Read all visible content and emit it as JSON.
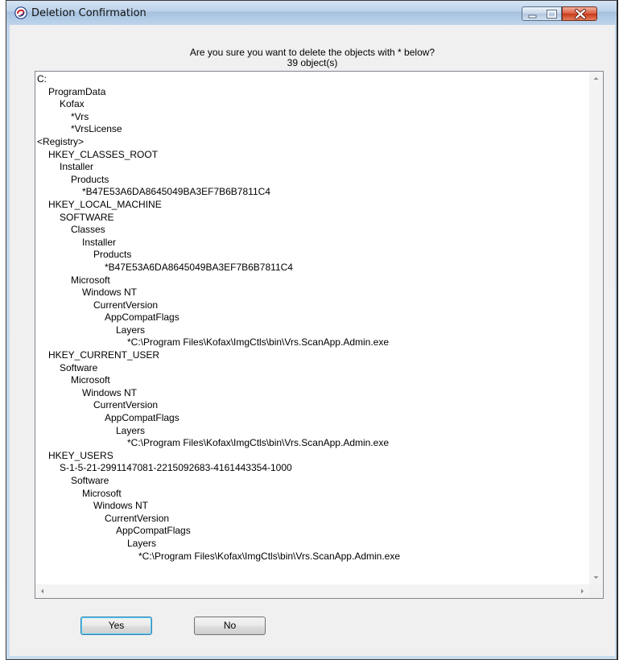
{
  "window": {
    "title": "Deletion Confirmation",
    "icon": "app-swirl-icon"
  },
  "dialog": {
    "question": "Are you sure you want to delete the objects with * below?",
    "count": "39 object(s)"
  },
  "tree": [
    {
      "indent": 0,
      "text": "C:"
    },
    {
      "indent": 1,
      "text": "ProgramData"
    },
    {
      "indent": 2,
      "text": "Kofax"
    },
    {
      "indent": 3,
      "text": "*Vrs"
    },
    {
      "indent": 3,
      "text": "*VrsLicense"
    },
    {
      "indent": 0,
      "text": "<Registry>"
    },
    {
      "indent": 1,
      "text": "HKEY_CLASSES_ROOT"
    },
    {
      "indent": 2,
      "text": "Installer"
    },
    {
      "indent": 3,
      "text": "Products"
    },
    {
      "indent": 4,
      "text": "*B47E53A6DA8645049BA3EF7B6B7811C4"
    },
    {
      "indent": 1,
      "text": "HKEY_LOCAL_MACHINE"
    },
    {
      "indent": 2,
      "text": "SOFTWARE"
    },
    {
      "indent": 3,
      "text": "Classes"
    },
    {
      "indent": 4,
      "text": "Installer"
    },
    {
      "indent": 5,
      "text": "Products"
    },
    {
      "indent": 6,
      "text": "*B47E53A6DA8645049BA3EF7B6B7811C4"
    },
    {
      "indent": 3,
      "text": "Microsoft"
    },
    {
      "indent": 4,
      "text": "Windows NT"
    },
    {
      "indent": 5,
      "text": "CurrentVersion"
    },
    {
      "indent": 6,
      "text": "AppCompatFlags"
    },
    {
      "indent": 7,
      "text": "Layers"
    },
    {
      "indent": 8,
      "text": "*C:\\Program Files\\Kofax\\ImgCtls\\bin\\Vrs.ScanApp.Admin.exe"
    },
    {
      "indent": 1,
      "text": "HKEY_CURRENT_USER"
    },
    {
      "indent": 2,
      "text": "Software"
    },
    {
      "indent": 3,
      "text": "Microsoft"
    },
    {
      "indent": 4,
      "text": "Windows NT"
    },
    {
      "indent": 5,
      "text": "CurrentVersion"
    },
    {
      "indent": 6,
      "text": "AppCompatFlags"
    },
    {
      "indent": 7,
      "text": "Layers"
    },
    {
      "indent": 8,
      "text": "*C:\\Program Files\\Kofax\\ImgCtls\\bin\\Vrs.ScanApp.Admin.exe"
    },
    {
      "indent": 1,
      "text": "HKEY_USERS"
    },
    {
      "indent": 2,
      "text": "S-1-5-21-2991147081-2215092683-4161443354-1000"
    },
    {
      "indent": 3,
      "text": "Software"
    },
    {
      "indent": 4,
      "text": "Microsoft"
    },
    {
      "indent": 5,
      "text": "Windows NT"
    },
    {
      "indent": 6,
      "text": "CurrentVersion"
    },
    {
      "indent": 7,
      "text": "AppCompatFlags"
    },
    {
      "indent": 8,
      "text": "Layers"
    },
    {
      "indent": 9,
      "text": "*C:\\Program Files\\Kofax\\ImgCtls\\bin\\Vrs.ScanApp.Admin.exe"
    }
  ],
  "buttons": {
    "yes": "Yes",
    "no": "No"
  }
}
